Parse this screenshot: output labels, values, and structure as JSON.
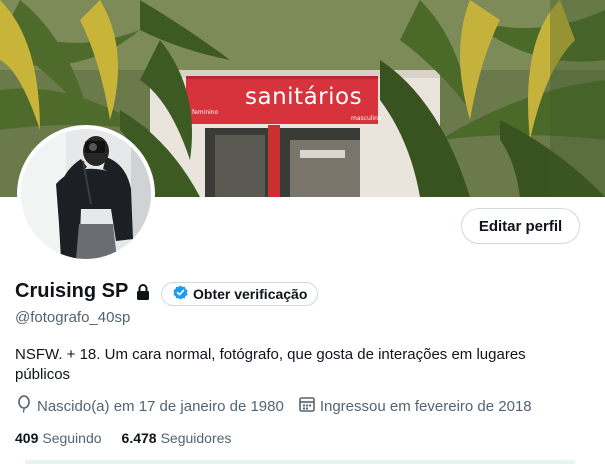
{
  "banner": {
    "sign_text": "sanitários",
    "sign_left_small": "feminino",
    "sign_right_small": "masculino"
  },
  "profile": {
    "edit_label": "Editar perfil",
    "name": "Cruising SP",
    "verify_label": "Obter verificação",
    "handle": "@fotografo_40sp",
    "bio": "NSFW. + 18. Um cara normal, fotógrafo, que gosta de interações em lugares públicos",
    "birth": "Nascido(a) em 17 de janeiro de 1980",
    "joined": "Ingressou em fevereiro de 2018",
    "following_count": "409",
    "following_label": "Seguindo",
    "followers_count": "6.478",
    "followers_label": "Seguidores"
  },
  "icons": {
    "lock": "lock-icon",
    "verify": "verified-badge-icon",
    "birth": "balloon-icon",
    "joined": "calendar-icon"
  },
  "colors": {
    "text_primary": "#0f1419",
    "text_secondary": "#536471",
    "verify_blue": "#1d9bf0",
    "border": "#cfd9de",
    "sign_red": "#d6333c"
  }
}
